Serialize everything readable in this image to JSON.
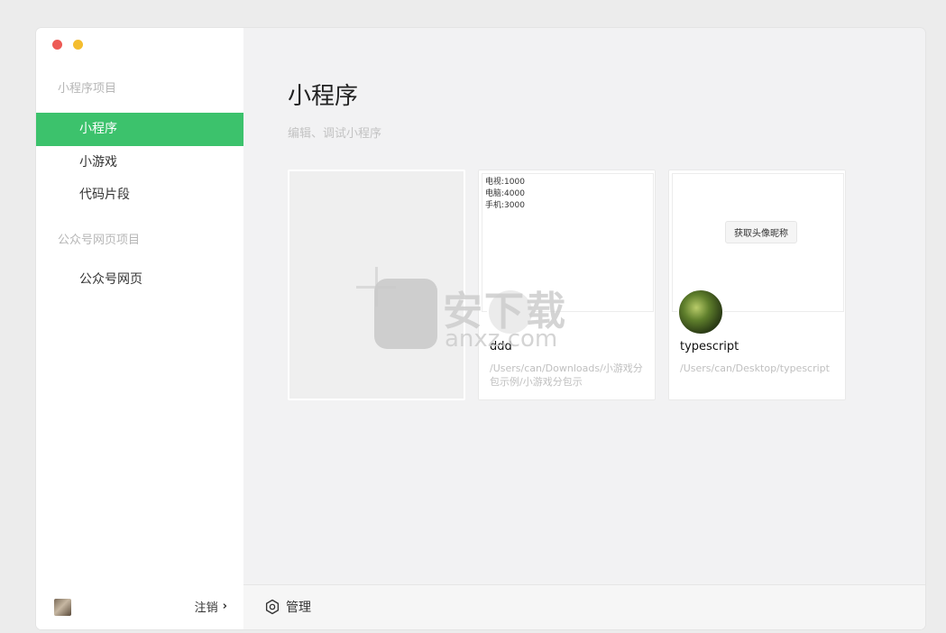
{
  "sidebar": {
    "group1_title": "小程序项目",
    "items": [
      {
        "label": "小程序",
        "active": true
      },
      {
        "label": "小游戏",
        "active": false
      },
      {
        "label": "代码片段",
        "active": false
      }
    ],
    "group2_title": "公众号网页项目",
    "items2": [
      {
        "label": "公众号网页",
        "active": false
      }
    ],
    "logout_label": "注销",
    "accent_color": "#3cc26c"
  },
  "main": {
    "title": "小程序",
    "subtitle": "编辑、调试小程序",
    "cards": [
      {
        "name": "ddd",
        "thumb_lines": [
          "电视:1000",
          "电脑:4000",
          "手机:3000"
        ],
        "path": "/Users/can/Downloads/小游戏分包示例/小游戏分包示"
      },
      {
        "name": "typescript",
        "thumb_button": "获取头像昵称",
        "path": "/Users/can/Desktop/typescript"
      }
    ],
    "manage_label": "管理"
  },
  "watermark": {
    "text": "安下载",
    "sub": "anxz.com"
  }
}
